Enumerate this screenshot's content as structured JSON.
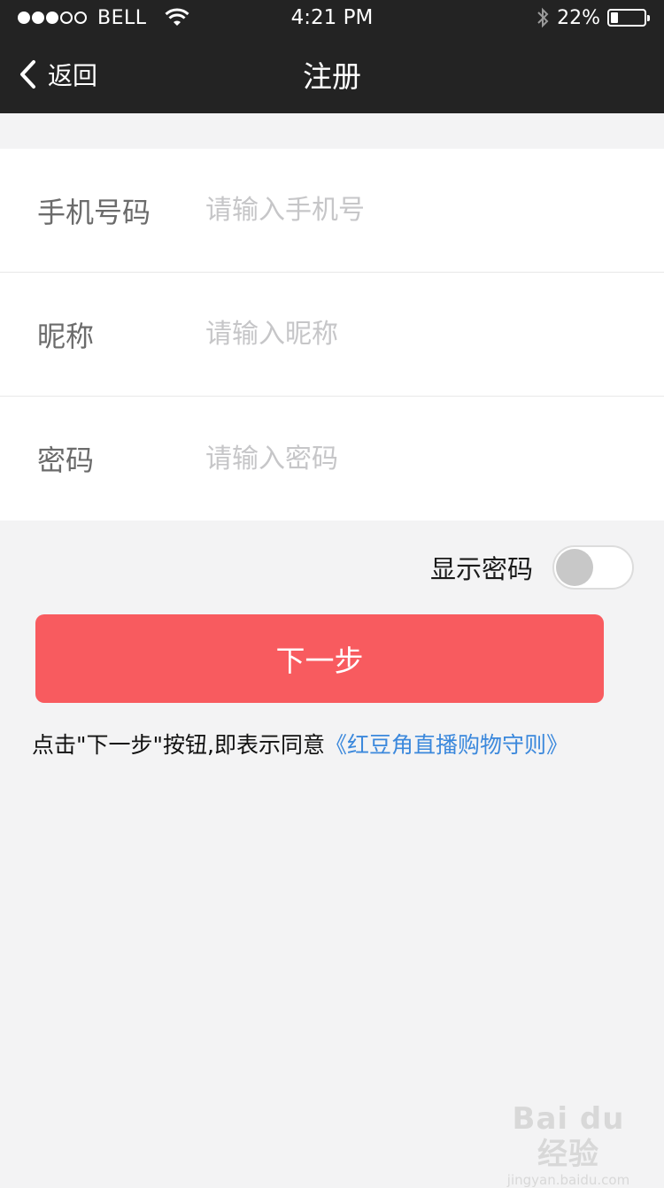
{
  "status_bar": {
    "carrier": "BELL",
    "signal_filled": 3,
    "signal_total": 5,
    "time": "4:21 PM",
    "battery_percent": "22%",
    "battery_level": 0.22,
    "icons": [
      "signal-dots-icon",
      "wifi-icon",
      "bluetooth-icon",
      "battery-icon"
    ]
  },
  "nav": {
    "back_label": "返回",
    "title": "注册"
  },
  "form": {
    "phone": {
      "label": "手机号码",
      "placeholder": "请输入手机号",
      "value": ""
    },
    "nickname": {
      "label": "昵称",
      "placeholder": "请输入昵称",
      "value": ""
    },
    "password": {
      "label": "密码",
      "placeholder": "请输入密码",
      "value": ""
    }
  },
  "show_password": {
    "label": "显示密码",
    "enabled": false
  },
  "next_button": {
    "label": "下一步"
  },
  "agreement": {
    "text": "点击\"下一步\"按钮,即表示同意",
    "link": "《红豆角直播购物守则》"
  },
  "watermark": {
    "logo": "Bai du 经验",
    "url": "jingyan.baidu.com"
  },
  "colors": {
    "bar_background": "#232323",
    "page_background": "#f3f3f4",
    "primary_button": "#f85b5f",
    "link": "#3b88dc",
    "placeholder": "#c6c6c8"
  }
}
